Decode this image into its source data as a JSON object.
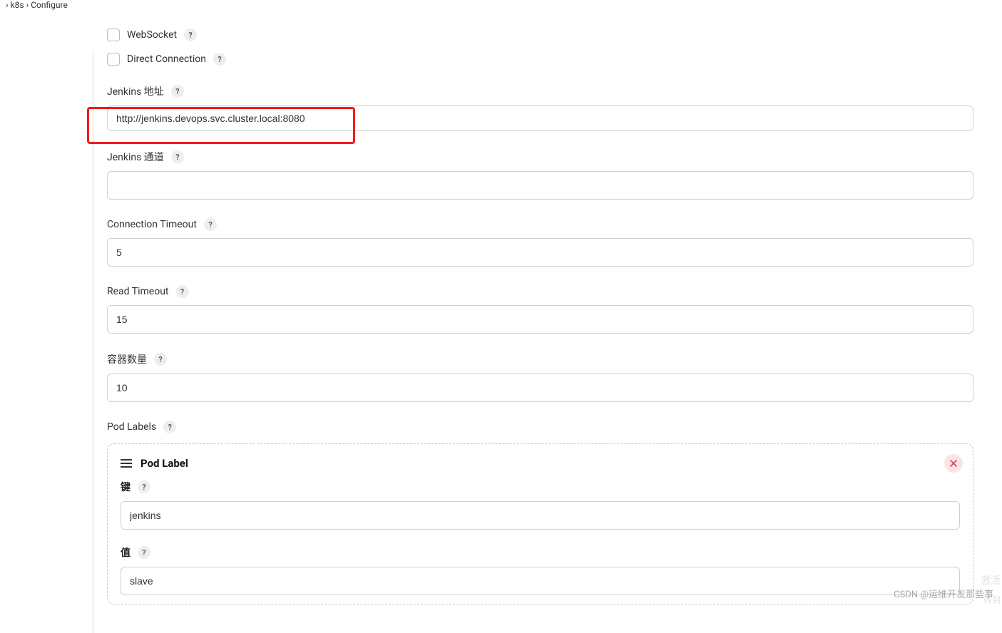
{
  "breadcrumb": {
    "sep": "›",
    "item2": "k8s",
    "item3": "Configure"
  },
  "form": {
    "websocket_label": "WebSocket",
    "direct_connection_label": "Direct Connection",
    "jenkins_url_label": "Jenkins 地址",
    "jenkins_url_value": "http://jenkins.devops.svc.cluster.local:8080",
    "jenkins_tunnel_label": "Jenkins 通道",
    "jenkins_tunnel_value": "",
    "connection_timeout_label": "Connection Timeout",
    "connection_timeout_value": "5",
    "read_timeout_label": "Read Timeout",
    "read_timeout_value": "15",
    "container_cap_label": "容器数量",
    "container_cap_value": "10",
    "pod_labels_label": "Pod Labels",
    "pod_label_section_title": "Pod Label",
    "pod_label_key_label": "键",
    "pod_label_key_value": "jenkins",
    "pod_label_value_label": "值",
    "pod_label_value_value": "slave"
  },
  "help_glyph": "?",
  "watermark": "CSDN @运维开发那些事",
  "faint1": "激活",
  "faint2": "转到"
}
